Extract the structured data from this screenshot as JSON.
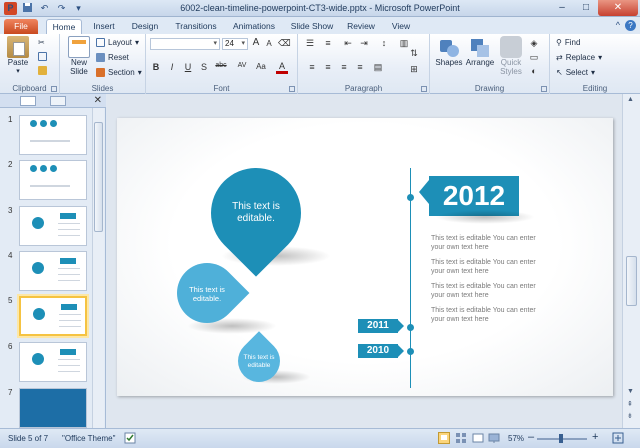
{
  "window": {
    "title": "6002-clean-timeline-powerpoint-CT3-wide.pptx - Microsoft PowerPoint",
    "app_logo": "P",
    "minimize": "–",
    "maximize": "□",
    "close": "✕"
  },
  "tabs": [
    {
      "label": "File"
    },
    {
      "label": "Home"
    },
    {
      "label": "Insert"
    },
    {
      "label": "Design"
    },
    {
      "label": "Transitions"
    },
    {
      "label": "Animations"
    },
    {
      "label": "Slide Show"
    },
    {
      "label": "Review"
    },
    {
      "label": "View"
    }
  ],
  "ribbon": {
    "clipboard": {
      "label": "Clipboard",
      "paste": "Paste"
    },
    "slides": {
      "label": "Slides",
      "new_slide": "New Slide",
      "layout": "Layout",
      "reset": "Reset",
      "section": "Section"
    },
    "font": {
      "label": "Font",
      "size": "24",
      "bold": "B",
      "italic": "I",
      "underline": "U",
      "strike": "S",
      "shadow": "abc",
      "spacing": "AV",
      "case": "Aa",
      "color": "A",
      "grow": "A",
      "shrink": "A"
    },
    "paragraph": {
      "label": "Paragraph"
    },
    "drawing": {
      "label": "Drawing",
      "shapes": "Shapes",
      "arrange": "Arrange",
      "quick_styles": "Quick Styles"
    },
    "editing": {
      "label": "Editing",
      "find": "Find",
      "replace": "Replace",
      "select": "Select"
    }
  },
  "slides_panel": {
    "slides": [
      {
        "num": "1"
      },
      {
        "num": "2"
      },
      {
        "num": "3"
      },
      {
        "num": "4"
      },
      {
        "num": "5"
      },
      {
        "num": "6"
      },
      {
        "num": "7"
      }
    ],
    "selected": "5"
  },
  "slide": {
    "drop_large": "This text is editable.",
    "drop_medium": "This text is editable.",
    "drop_small": "This text is editable",
    "year_main": "2012",
    "year_a": "2011",
    "year_b": "2010",
    "paragraphs": [
      "This text is editable You can enter your own text here",
      "This text is editable You can enter your own text here",
      "This text is editable You can enter your own text here",
      "This text is editable You can enter your own text here"
    ]
  },
  "status": {
    "slide_info": "Slide 5 of 7",
    "theme": "\"Office Theme\"",
    "zoom": "57%",
    "minus": "–",
    "plus": "+"
  },
  "colors": {
    "accent": "#1d8fb7",
    "file_tab": "#d24726"
  }
}
